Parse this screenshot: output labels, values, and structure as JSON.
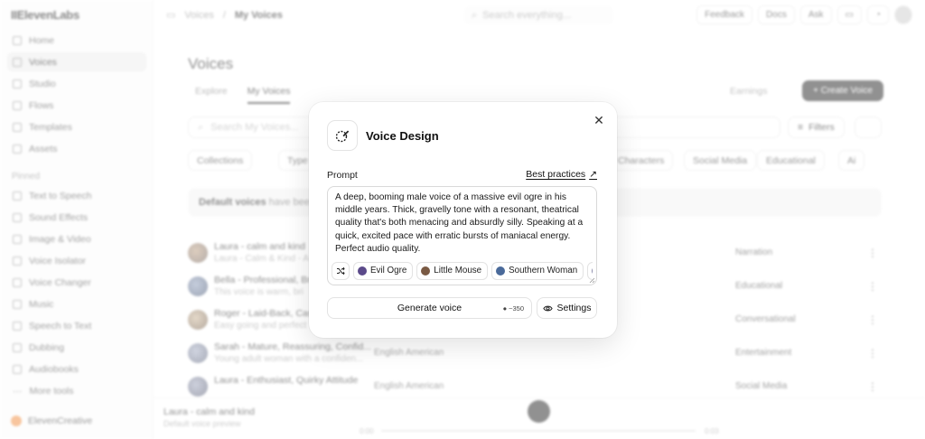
{
  "app": {
    "logo": "IIElevenLabs",
    "nav": [
      "Home",
      "Voices",
      "Studio",
      "Flows",
      "Templates",
      "Assets"
    ],
    "pinned_label": "Pinned",
    "pinned": [
      "Text to Speech",
      "Sound Effects",
      "Image & Video",
      "Voice Isolator",
      "Voice Changer",
      "Music",
      "Speech to Text",
      "Dubbing",
      "Audiobooks"
    ],
    "more_tools": "More tools",
    "workspace": "ElevenCreative"
  },
  "topbar": {
    "crumb1": "Voices",
    "crumb2": "My Voices",
    "search_placeholder": "Search everything...",
    "buttons": [
      "Feedback",
      "Docs",
      "Ask"
    ]
  },
  "page": {
    "title": "Voices",
    "tabs": [
      "Explore",
      "My Voices"
    ],
    "earnings": "Earnings",
    "create": "+ Create Voice",
    "search_placeholder": "Search My Voices...",
    "filters": "Filters",
    "chips": [
      "Collections",
      "Type",
      "Characters",
      "Social Media",
      "Educational",
      "Ai"
    ],
    "notice_bold": "Default voices",
    "notice_text": "have been e"
  },
  "rows": [
    {
      "name": "Laura - calm and kind",
      "desc": "Laura - Calm & Kind - A",
      "lang": "",
      "category": "Narration"
    },
    {
      "name": "Bella - Professional, Bri",
      "desc": "This voice is warm, bri",
      "lang": "",
      "category": "Educational"
    },
    {
      "name": "Roger - Laid-Back, Cas",
      "desc": "Easy going and perfect",
      "lang": "",
      "category": "Conversational"
    },
    {
      "name": "Sarah - Mature, Reassuring, Confid...",
      "desc": "Young adult woman with a confiden...",
      "lang": "English   American",
      "category": "Entertainment"
    },
    {
      "name": "Laura - Enthusiast, Quirky Attitude",
      "desc": "",
      "lang": "English   American",
      "category": "Social Media"
    }
  ],
  "player": {
    "name": "Laura - calm and kind",
    "sub": "Default voice preview",
    "time_start": "0:00",
    "time_end": "0:03"
  },
  "modal": {
    "title": "Voice Design",
    "prompt_label": "Prompt",
    "best_practices": "Best practices",
    "prompt_text": "A deep, booming male voice of a massive evil ogre in his middle years. Thick, gravelly tone with a resonant, theatrical quality that's both menacing and absurdly silly. Speaking at a quick, excited pace with erratic bursts of maniacal energy. Perfect audio quality.",
    "suggestions": [
      {
        "label": "Evil Ogre",
        "color": "#5b4a8a"
      },
      {
        "label": "Little Mouse",
        "color": "#7a5a44"
      },
      {
        "label": "Southern Woman",
        "color": "#4a6a9a"
      },
      {
        "label": "",
        "color": "#8a8aaa"
      }
    ],
    "generate_label": "Generate voice",
    "credits": "~350",
    "settings_label": "Settings"
  }
}
